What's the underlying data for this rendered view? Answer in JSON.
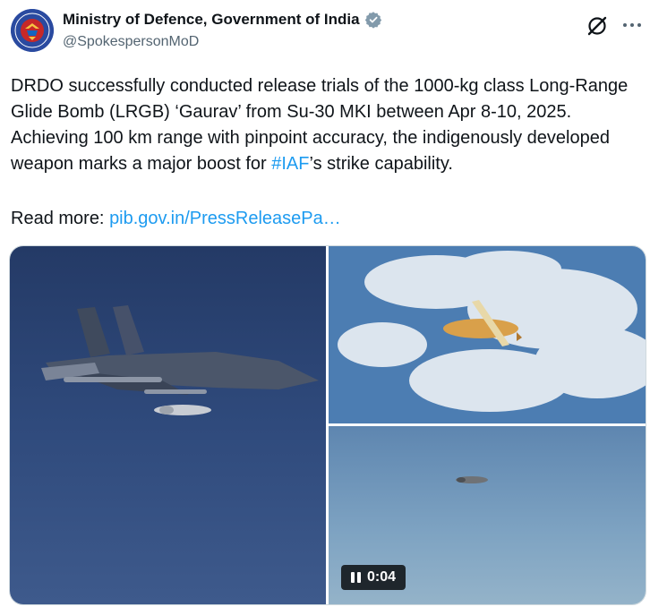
{
  "post": {
    "author_name": "Ministry of Defence, Government of India",
    "author_handle": "@SpokespersonMoD",
    "text_before_hashtag": "DRDO successfully conducted release trials of the 1000-kg class Long-Range Glide Bomb (LRGB) ‘Gaurav’ from Su-30 MKI between Apr 8-10, 2025. Achieving 100 km range with pinpoint accuracy, the indigenously developed weapon marks a major boost for ",
    "hashtag": "#IAF",
    "text_after_hashtag": "’s strike capability.",
    "read_more_label": "Read more: ",
    "link_text": "pib.gov.in/PressReleasePa…"
  },
  "media": {
    "video_duration": "0:04",
    "icons": {
      "avatar": "ministry-of-defence-emblem",
      "verified": "verified-badge-icon",
      "grok": "grok-icon",
      "more": "more-icon",
      "pause": "pause-icon"
    }
  },
  "colors": {
    "link": "#1d9bf0",
    "text": "#0f1419",
    "secondary": "#536471",
    "verified": "#829aab",
    "avatar_bg": "#2a4aa0"
  }
}
